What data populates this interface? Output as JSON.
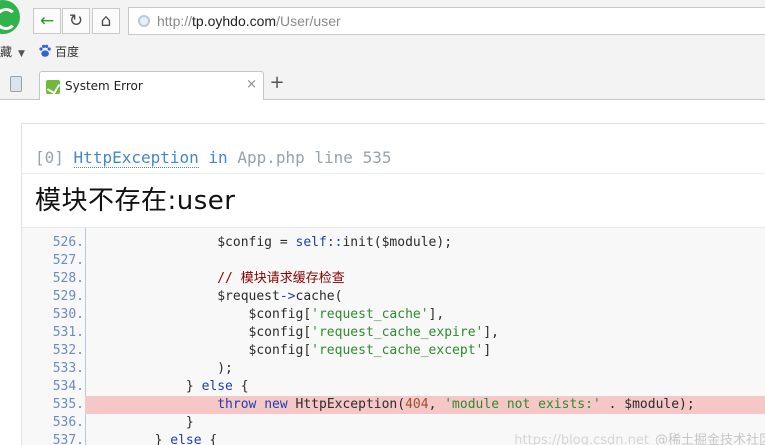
{
  "browser": {
    "address": {
      "scheme": "http://",
      "domain": "tp.oyhdo.com",
      "path": "/User/user"
    },
    "bookmarks": {
      "favorites_label": "藏",
      "baidu_label": "百度"
    },
    "tab": {
      "title": "System Error",
      "close": "×",
      "new_tab": "+"
    }
  },
  "exception": {
    "index": "[0]",
    "class_name": "HttpException",
    "in_word": "in",
    "file": "App.php",
    "line_word": "line",
    "line_number": "535",
    "message": "模块不存在:user"
  },
  "code": {
    "highlight_line": "535.",
    "lines": [
      {
        "num": "526.",
        "text": "                $config = self::init($module);"
      },
      {
        "num": "527.",
        "text": ""
      },
      {
        "num": "528.",
        "text": "                // 模块请求缓存检查"
      },
      {
        "num": "529.",
        "text": "                $request->cache("
      },
      {
        "num": "530.",
        "text": "                    $config['request_cache'],"
      },
      {
        "num": "531.",
        "text": "                    $config['request_cache_expire'],"
      },
      {
        "num": "532.",
        "text": "                    $config['request_cache_except']"
      },
      {
        "num": "533.",
        "text": "                );"
      },
      {
        "num": "534.",
        "text": "            } else {"
      },
      {
        "num": "535.",
        "text": "                throw new HttpException(404, 'module not exists:' . $module);"
      },
      {
        "num": "536.",
        "text": "            }"
      },
      {
        "num": "537.",
        "text": "        } else {"
      }
    ]
  },
  "watermark": {
    "url": "https://blog.csdn.net",
    "text": "@稀土掘金技术社区"
  },
  "colors": {
    "highlight": "#f5c7c7",
    "link": "#4288ce",
    "line_number": "#6a8ac9"
  }
}
